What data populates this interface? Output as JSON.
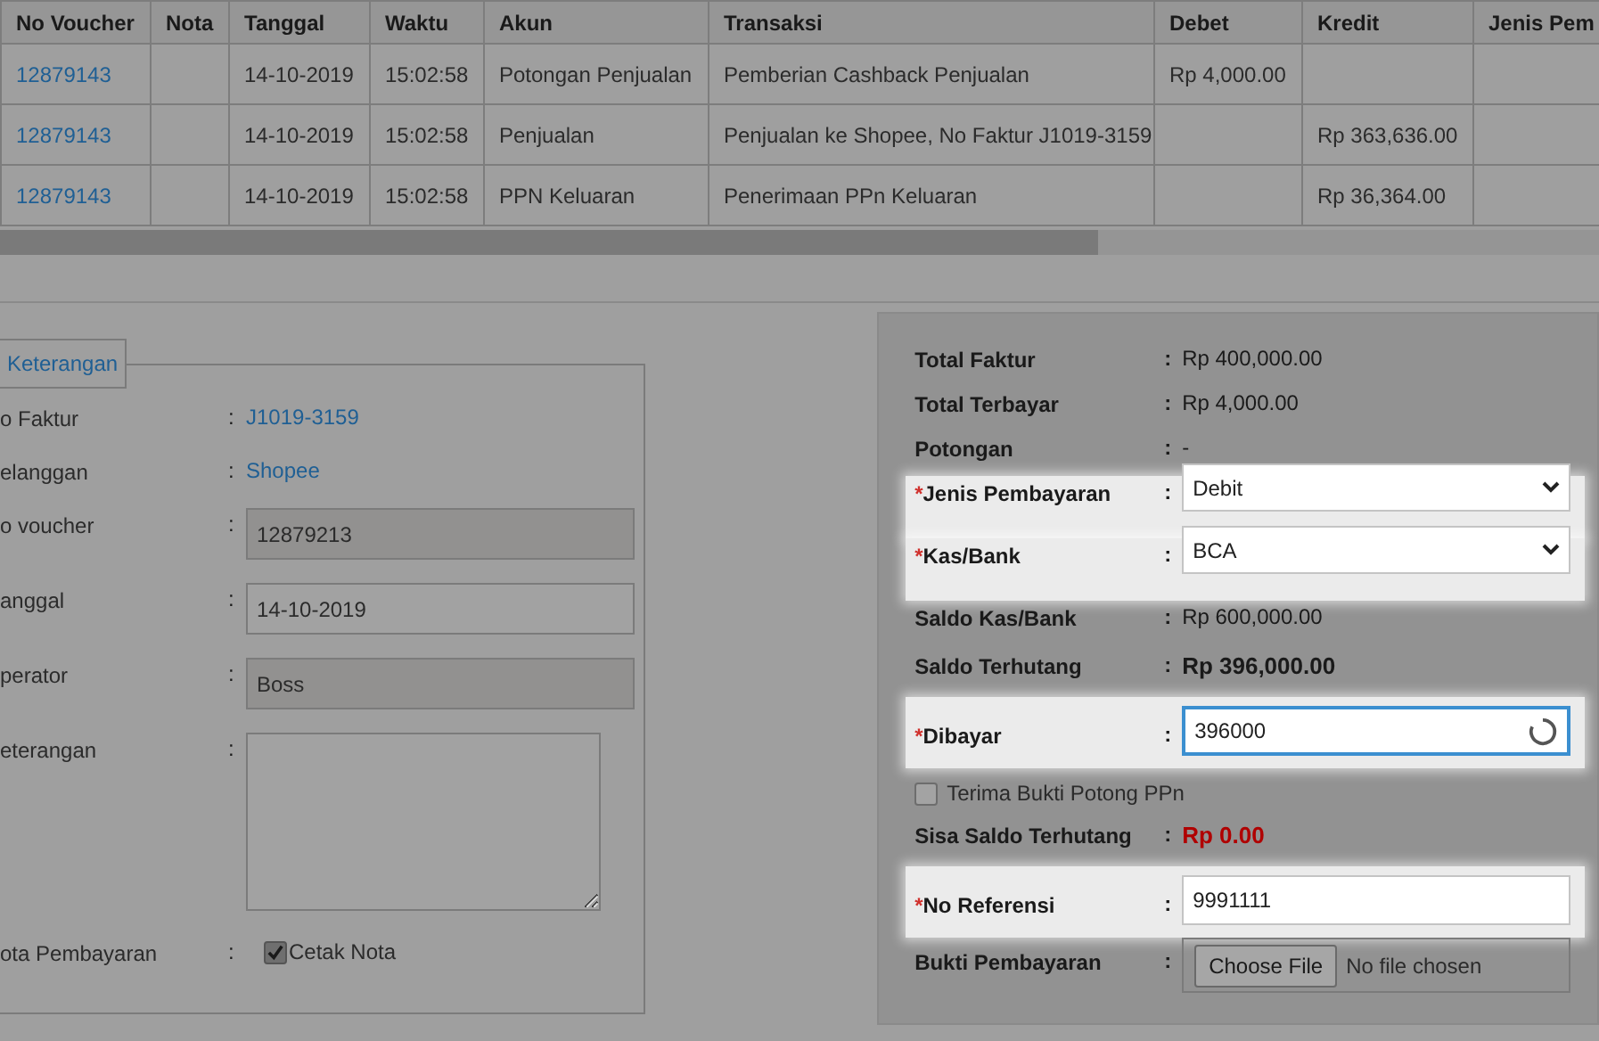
{
  "table": {
    "columns": [
      "No Voucher",
      "Nota",
      "Tanggal",
      "Waktu",
      "Akun",
      "Transaksi",
      "Debet",
      "Kredit",
      "Jenis Pem"
    ],
    "rows": [
      {
        "no_voucher": "12879143",
        "tanggal": "14-10-2019",
        "waktu": "15:02:58",
        "akun": "Potongan Penjualan",
        "transaksi": "Pemberian Cashback Penjualan",
        "debet": "Rp 4,000.00"
      },
      {
        "no_voucher": "12879143",
        "tanggal": "14-10-2019",
        "waktu": "15:02:58",
        "akun": "Penjualan",
        "transaksi": "Penjualan ke Shopee, No Faktur J1019-3159",
        "kredit": "Rp 363,636.00"
      },
      {
        "no_voucher": "12879143",
        "tanggal": "14-10-2019",
        "waktu": "15:02:58",
        "akun": "PPN Keluaran",
        "transaksi": "Penerimaan PPn Keluaran",
        "kredit": "Rp 36,364.00"
      }
    ]
  },
  "left_panel": {
    "legend": "Keterangan",
    "separator": ":",
    "fields": [
      {
        "kind": "link",
        "label": "o Faktur",
        "value": "J1019-3159"
      },
      {
        "kind": "link",
        "label": "elanggan",
        "value": "Shopee"
      },
      {
        "kind": "input",
        "label": "o voucher",
        "value": "12879213",
        "readonly": true
      },
      {
        "kind": "input",
        "label": "anggal",
        "value": "14-10-2019",
        "readonly": false
      },
      {
        "kind": "input",
        "label": "perator",
        "value": "Boss",
        "readonly": true
      },
      {
        "kind": "textarea",
        "label": "eterangan"
      },
      {
        "kind": "checkbox",
        "label": "ota Pembayaran",
        "option": "Cetak Nota",
        "checked": true
      }
    ]
  },
  "right_panel": {
    "separator": ":",
    "required_mark": "*",
    "fields": [
      {
        "kind": "text",
        "label": "Total Faktur",
        "value": "Rp 400,000.00",
        "bold": false,
        "alert": false
      },
      {
        "kind": "text",
        "label": "Total Terbayar",
        "value": "Rp 4,000.00",
        "bold": false,
        "alert": false
      },
      {
        "kind": "text",
        "label": "Potongan",
        "value": "-",
        "bold": false,
        "alert": false
      },
      {
        "kind": "select",
        "label": "Jenis Pembayaran",
        "required": true,
        "highlighted": true,
        "value": "Debit"
      },
      {
        "kind": "select",
        "label": "Kas/Bank",
        "required": true,
        "highlighted": true,
        "value": "BCA"
      },
      {
        "kind": "text",
        "label": "Saldo Kas/Bank",
        "value": "Rp 600,000.00",
        "bold": false,
        "alert": false
      },
      {
        "kind": "text",
        "label": "Saldo Terhutang",
        "value": "Rp 396,000.00",
        "bold": true,
        "alert": false
      },
      {
        "kind": "input",
        "label": "Dibayar",
        "required": true,
        "highlighted": true,
        "value": "396000",
        "focused": true
      },
      {
        "kind": "checkbox",
        "option": "Terima Bukti Potong PPn",
        "checked": false
      },
      {
        "kind": "text",
        "label": "Sisa Saldo Terhutang",
        "value": "Rp 0.00",
        "bold": true,
        "alert": true
      },
      {
        "kind": "input",
        "label": "No Referensi",
        "required": true,
        "highlighted": true,
        "value": "9991111",
        "focused": false
      },
      {
        "kind": "file",
        "label": "Bukti Pembayaran",
        "button": "Choose File",
        "status": "No file chosen"
      }
    ]
  }
}
